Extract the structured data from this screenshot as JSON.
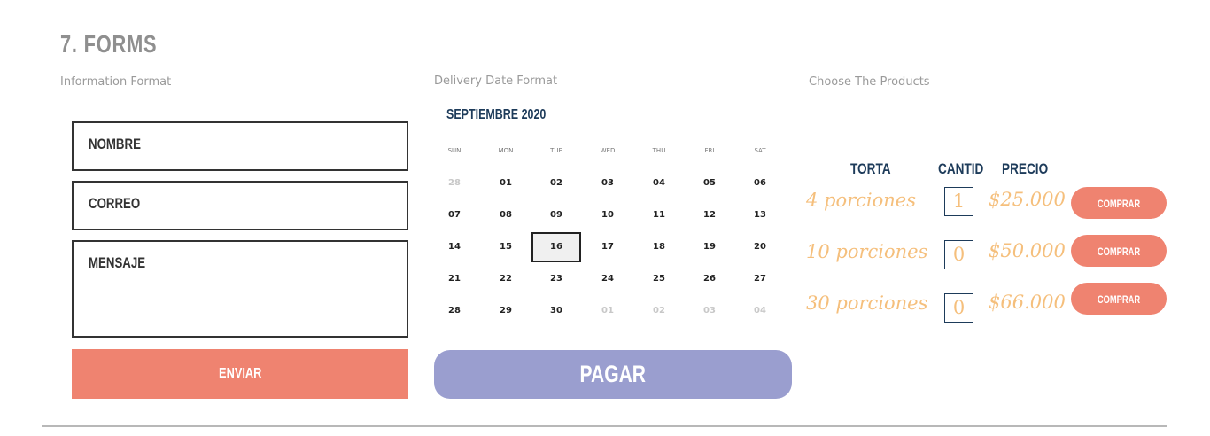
{
  "section_title": "7. FORMS",
  "info_section": {
    "heading": "Information Format",
    "fields": {
      "name": "NOMBRE",
      "email": "CORREO",
      "message": "MENSAJE"
    },
    "submit_label": "ENVIAR"
  },
  "delivery_section": {
    "heading": "Delivery Date Format",
    "month_label": "SEPTIEMBRE 2020",
    "weekdays": [
      "SUN",
      "MON",
      "TUE",
      "WED",
      "THU",
      "FRI",
      "SAT"
    ],
    "weeks": [
      [
        "28",
        "01",
        "02",
        "03",
        "04",
        "05",
        "06"
      ],
      [
        "07",
        "08",
        "09",
        "10",
        "11",
        "12",
        "13"
      ],
      [
        "14",
        "15",
        "16",
        "17",
        "18",
        "19",
        "20"
      ],
      [
        "21",
        "22",
        "23",
        "24",
        "25",
        "26",
        "27"
      ],
      [
        "28",
        "29",
        "30",
        "01",
        "02",
        "03",
        "04"
      ]
    ],
    "selected_day": "16",
    "pay_label": "PAGAR"
  },
  "products_section": {
    "heading": "Choose The Products",
    "columns": {
      "product": "TORTA",
      "quantity": "CANTID",
      "price": "PRECIO"
    },
    "rows": [
      {
        "portions": "4 porciones",
        "quantity": "1",
        "price": "$25.000",
        "buy_label": "COMPRAR"
      },
      {
        "portions": "10 porciones",
        "quantity": "0",
        "price": "$50.000",
        "buy_label": "COMPRAR"
      },
      {
        "portions": "30 porciones",
        "quantity": "0",
        "price": "$66.000",
        "buy_label": "COMPRAR"
      }
    ]
  },
  "colors": {
    "coral": "#ef8370",
    "lavender": "#9a9ecf",
    "navy": "#1d3b5a",
    "peach": "#f5bf7c",
    "grey_title": "#8f8f8f"
  }
}
